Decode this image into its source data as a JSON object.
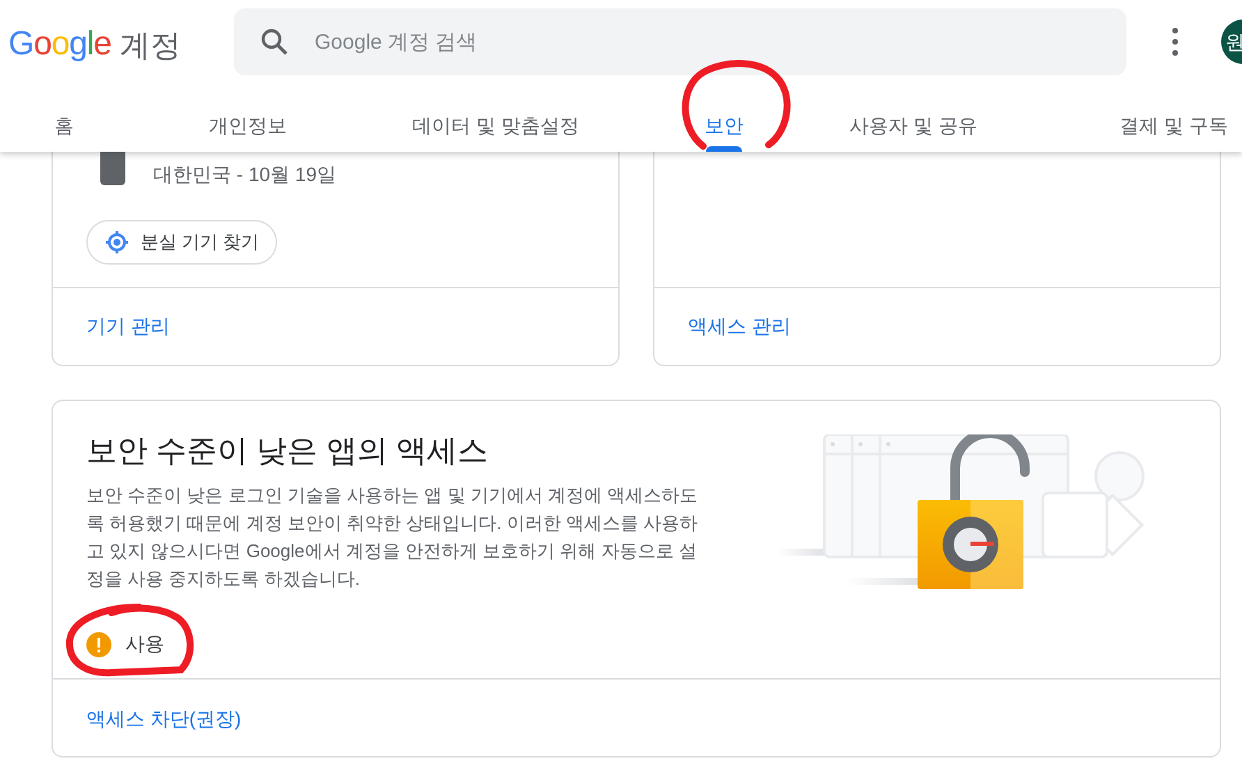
{
  "header": {
    "logo": {
      "brand": "Google",
      "product": "계정"
    },
    "search": {
      "placeholder": "Google 계정 검색"
    },
    "avatar": {
      "initial": "원"
    }
  },
  "tabs": [
    {
      "label": "홈",
      "selected": false
    },
    {
      "label": "개인정보",
      "selected": false
    },
    {
      "label": "데이터 및 맞춤설정",
      "selected": false
    },
    {
      "label": "보안",
      "selected": true
    },
    {
      "label": "사용자 및 공유",
      "selected": false
    },
    {
      "label": "결제 및 구독",
      "selected": false
    }
  ],
  "device_card": {
    "device_detail": "대한민국 - 10월 19일",
    "find_button": "분실 기기 찾기",
    "link": "기기 관리"
  },
  "access_card": {
    "link": "액세스 관리"
  },
  "less_secure_card": {
    "title": "보안 수준이 낮은 앱의 액세스",
    "description": "보안 수준이 낮은 로그인 기술을 사용하는 앱 및 기기에서 계정에 액세스하도록 허용했기 때문에 계정 보안이 취약한 상태입니다. 이러한 액세스를 사용하고 있지 않으시다면 Google에서 계정을 안전하게 보호하기 위해 자동으로 설정을 사용 중지하도록 하겠습니다.",
    "status": {
      "label": "사용",
      "on": true
    },
    "link": "액세스 차단(권장)"
  }
}
